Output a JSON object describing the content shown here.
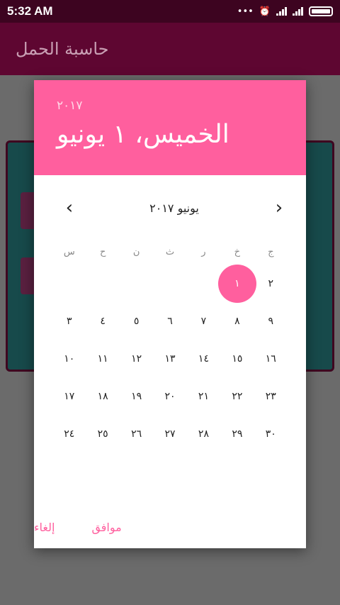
{
  "status_bar": {
    "time": "5:32 AM",
    "icons": [
      "dots-icon",
      "alarm-icon",
      "signal-icon",
      "signal-icon",
      "battery-icon"
    ]
  },
  "app_bar": {
    "title": "حاسبة الحمل"
  },
  "dialog": {
    "year": "٢٠١٧",
    "selected_date": "الخميس، ١ يونيو",
    "month_title": "يونيو ٢٠١٧",
    "weekdays": [
      "ج",
      "خ",
      "ر",
      "ث",
      "ن",
      "ح",
      "س"
    ],
    "weeks": [
      [
        "٢",
        "١",
        "",
        "",
        "",
        "",
        ""
      ],
      [
        "٩",
        "٨",
        "٧",
        "٦",
        "٥",
        "٤",
        "٣"
      ],
      [
        "١٦",
        "١٥",
        "١٤",
        "١٣",
        "١٢",
        "١١",
        "١٠"
      ],
      [
        "٢٣",
        "٢٢",
        "٢١",
        "٢٠",
        "١٩",
        "١٨",
        "١٧"
      ],
      [
        "٣٠",
        "٢٩",
        "٢٨",
        "٢٧",
        "٢٦",
        "٢٥",
        "٢٤"
      ]
    ],
    "selected_day": "١",
    "ok_label": "موافق",
    "cancel_label": "إلغاء"
  },
  "colors": {
    "status_bar": "#3d0420",
    "app_bar": "#5e0631",
    "accent": "#ff5f9e",
    "card": "#174a4b"
  }
}
